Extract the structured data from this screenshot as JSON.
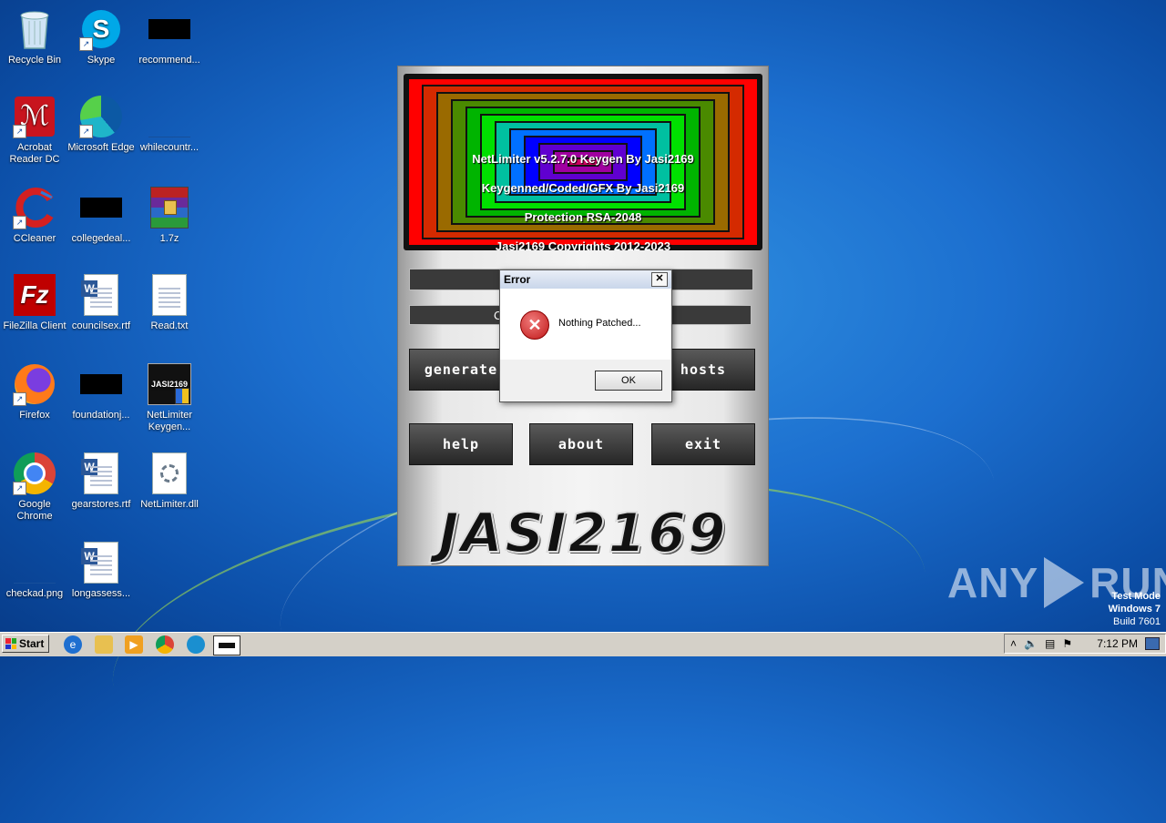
{
  "desktop": {
    "icons": [
      {
        "label": "Recycle Bin",
        "icon": "recycle-bin-icon"
      },
      {
        "label": "Skype",
        "icon": "skype-icon"
      },
      {
        "label": "recommend...",
        "icon": "black-thumbnail-icon"
      },
      {
        "label": "Acrobat Reader DC",
        "icon": "acrobat-icon"
      },
      {
        "label": "Microsoft Edge",
        "icon": "edge-icon"
      },
      {
        "label": "whilecountr...",
        "icon": "blank-thumbnail-icon"
      },
      {
        "label": "CCleaner",
        "icon": "ccleaner-icon"
      },
      {
        "label": "collegedeal...",
        "icon": "black-thumbnail-icon"
      },
      {
        "label": "1.7z",
        "icon": "winrar-icon"
      },
      {
        "label": "FileZilla Client",
        "icon": "filezilla-icon"
      },
      {
        "label": "councilsex.rtf",
        "icon": "word-doc-icon"
      },
      {
        "label": "Read.txt",
        "icon": "text-file-icon"
      },
      {
        "label": "Firefox",
        "icon": "firefox-icon"
      },
      {
        "label": "foundationj...",
        "icon": "black-thumbnail-icon"
      },
      {
        "label": "NetLimiter Keygen...",
        "icon": "keygen-exe-icon"
      },
      {
        "label": "Google Chrome",
        "icon": "chrome-icon"
      },
      {
        "label": "gearstores.rtf",
        "icon": "word-doc-icon"
      },
      {
        "label": "NetLimiter.dll",
        "icon": "dll-file-icon"
      },
      {
        "label": "checkad.png",
        "icon": "blank-thumbnail-icon"
      },
      {
        "label": "longassess...",
        "icon": "word-doc-icon"
      }
    ]
  },
  "keygen": {
    "banner_lines": [
      "NetLimiter v5.2.7.0 Keygen By Jasi2169",
      "Keygenned/Coded/GFX By Jasi2169",
      "Protection RSA-2048",
      "Jasi2169 Copyrights 2012-2023"
    ],
    "field1_value": "",
    "field2_value": "C",
    "buttons": {
      "generate": "GENERATE",
      "hosts": "HOSTS",
      "help": "HELP",
      "about": "ABOUT",
      "exit": "EXIT"
    },
    "logo_text": "JASI2169",
    "ring_colors": [
      "#ff0000",
      "#d42a00",
      "#9a6a00",
      "#4a8a00",
      "#00b400",
      "#00e000",
      "#00c0a0",
      "#0070ff",
      "#0000ff",
      "#6000d0",
      "#a000a0",
      "#d00060"
    ]
  },
  "error_dialog": {
    "title": "Error",
    "close_glyph": "✕",
    "icon_glyph": "✕",
    "message": "Nothing Patched...",
    "ok_label": "OK"
  },
  "watermark": {
    "left": "ANY",
    "right": "RUN",
    "test_mode": "Test Mode",
    "os": "Windows 7",
    "build": "Build 7601"
  },
  "taskbar": {
    "start_label": "Start",
    "clock": "7:12 PM",
    "tray_icons": [
      "up-arrow-icon",
      "volume-icon",
      "network-icon",
      "flag-icon",
      "show-desktop-icon"
    ]
  }
}
